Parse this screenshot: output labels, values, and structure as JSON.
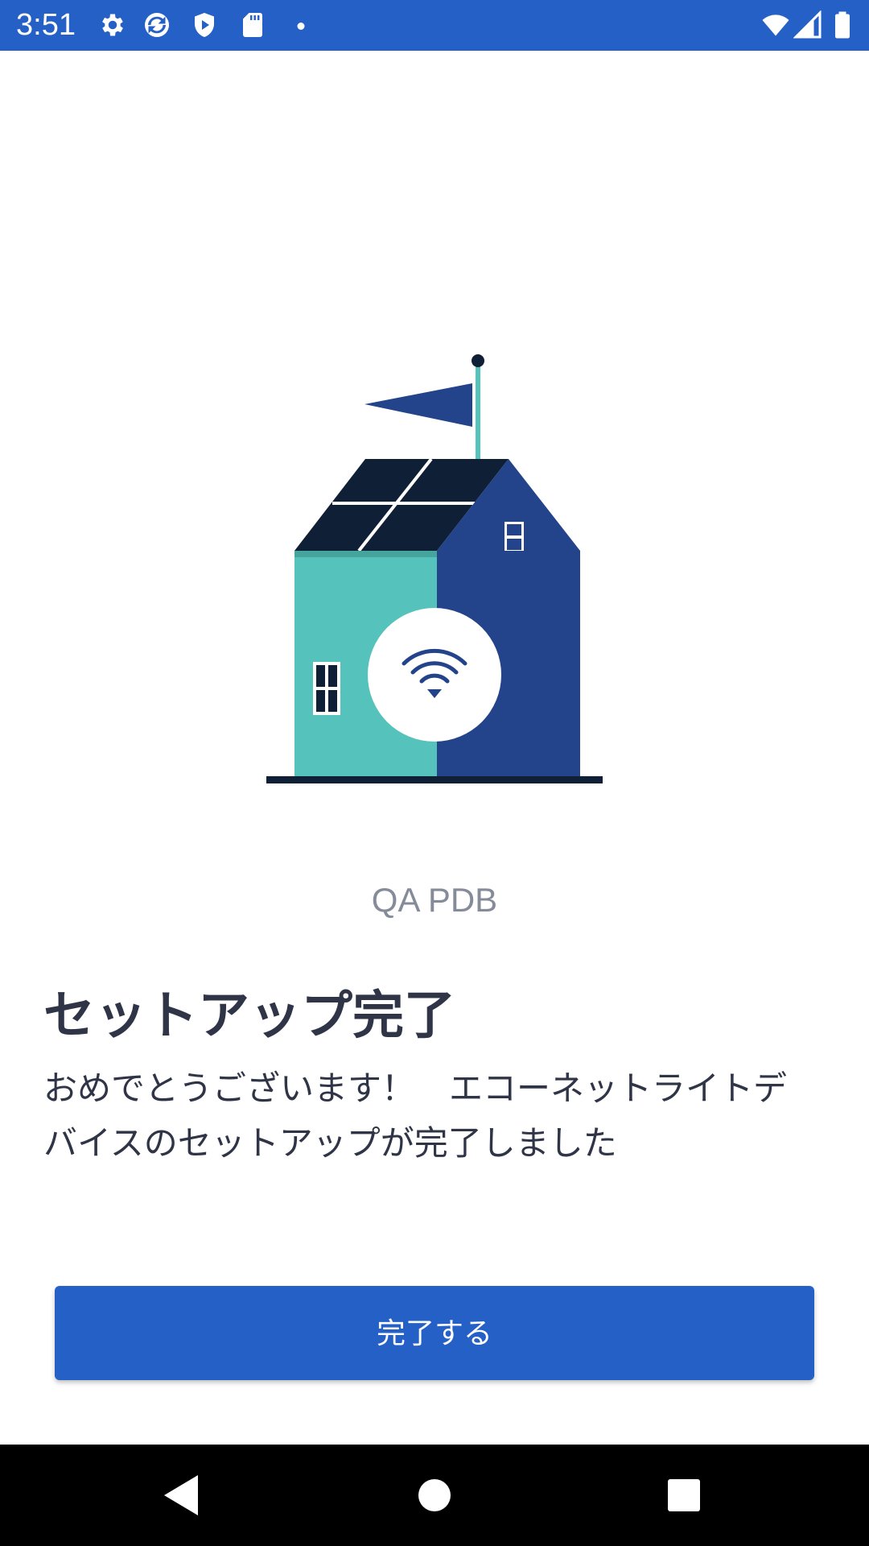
{
  "status_bar": {
    "time": "3:51",
    "background_color": "#2460c6",
    "left_icons": [
      "gear-icon",
      "sync-icon",
      "play-protect-icon",
      "sd-card-icon",
      "notification-dot-icon"
    ],
    "right_icons": [
      "wifi-icon",
      "cell-signal-icon",
      "battery-icon"
    ]
  },
  "illustration": {
    "icon": "house-wifi-illustration",
    "colors": {
      "teal": "#55c3bb",
      "navy": "#23438a",
      "dark": "#0f1f35",
      "pole": "#55c3bb"
    }
  },
  "main": {
    "device_name": "QA PDB",
    "title": "セットアップ完了",
    "description": "おめでとうございます！　エコーネットライトデバイスのセットアップが完了しました"
  },
  "actions": {
    "done_label": "完了する",
    "accent_color": "#2460c6"
  },
  "nav_bar": {
    "items": [
      "back-icon",
      "home-icon",
      "recents-icon"
    ]
  }
}
